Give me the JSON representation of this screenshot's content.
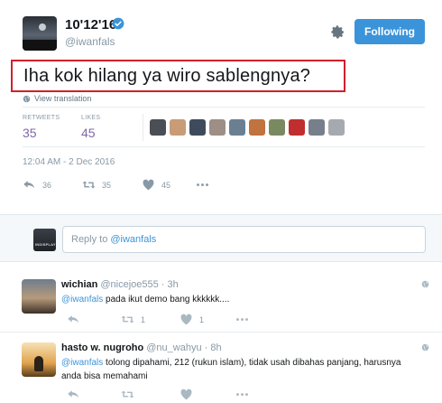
{
  "tweet": {
    "display_name": "10'12'16",
    "username": "@iwanfals",
    "text": "Iha kok hilang ya wiro sablengnya?",
    "translate_label": "View translation",
    "follow_label": "Following",
    "retweets_label": "RETWEETS",
    "retweets_count": "35",
    "likes_label": "LIKES",
    "likes_count": "45",
    "timestamp": "12:04 AM - 2 Dec 2016",
    "actions": {
      "reply_count": "36",
      "retweet_count": "35",
      "like_count": "45"
    },
    "likers": [
      "#4a4f55",
      "#c99b77",
      "#3f4a5d",
      "#9d8f86",
      "#6b7f92",
      "#c0723f",
      "#7a8a60",
      "#bf2f2f",
      "#77808a",
      "#a4aab0"
    ]
  },
  "reply_box": {
    "placeholder": "Reply to",
    "mention": "@iwanfals",
    "avatar_caption": "INDISPLAY"
  },
  "replies": [
    {
      "name": "wichian",
      "handle": "@nicejoe555 · 3h",
      "mention": "@iwanfals",
      "text": " pada ikut demo bang kkkkkk....",
      "retweet_count": "1",
      "like_count": "1"
    },
    {
      "name": "hasto w. nugroho",
      "handle": "@nu_wahyu · 8h",
      "mention": "@iwanfals",
      "text": " tolong dipahami, 212 (rukun islam), tidak usah dibahas panjang, harusnya anda bisa memahami"
    }
  ],
  "colors": {
    "accent": "#3b94d9",
    "highlight_border": "#d0202b",
    "stat_value": "#8067a8"
  }
}
